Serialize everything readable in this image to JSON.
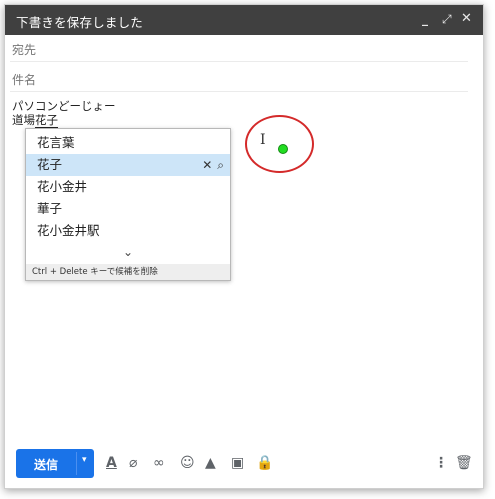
{
  "window": {
    "title": "下書きを保存しました",
    "controls": {
      "minimize": "_",
      "expand": "⤢",
      "close": "✕"
    }
  },
  "fields": {
    "to_placeholder": "宛先",
    "subject_placeholder": "件名"
  },
  "body": {
    "line1": "パソコンどーじょー",
    "line2_prefix": "道場",
    "line2_composing": "花子"
  },
  "ime": {
    "candidates": [
      "花言葉",
      "花子",
      "花小金井",
      "華子",
      "花小金井駅"
    ],
    "selected_index": 1,
    "selected_actions": {
      "delete": "✕",
      "search": "⌕"
    },
    "more_glyph": "⌄",
    "footer": "Ctrl + Delete キーで候補を削除"
  },
  "cursor": {
    "ibeam": "I"
  },
  "toolbar": {
    "send_label": "送信",
    "send_options_glyph": "▾",
    "icons": {
      "format": "A",
      "attach": "⌀",
      "link": "∞",
      "emoji": "☺",
      "drive": "▲",
      "photo": "▣",
      "confidential": "🔒",
      "more": "⋮",
      "trash": "🗑"
    }
  },
  "colors": {
    "titlebar": "#404040",
    "send_button": "#1a73e8",
    "selected_candidate": "#cde5f8",
    "annotation_circle": "#d42a2a",
    "cursor_dot": "#22dd22"
  }
}
